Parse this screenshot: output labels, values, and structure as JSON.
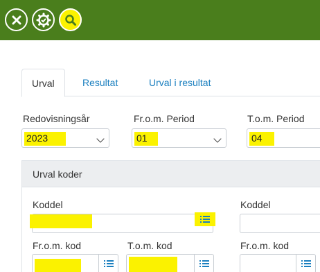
{
  "toolbar": {
    "buttons": [
      {
        "name": "close",
        "icon": "close-icon"
      },
      {
        "name": "settings",
        "icon": "gear-check-icon"
      },
      {
        "name": "search",
        "icon": "search-icon"
      }
    ],
    "colors": {
      "bar": "#4a7e1c",
      "highlight": "#fbf200",
      "link": "#1a7fbf"
    }
  },
  "tabs": [
    {
      "label": "Urval",
      "active": true
    },
    {
      "label": "Resultat",
      "active": false
    },
    {
      "label": "Urval i resultat",
      "active": false
    }
  ],
  "filters": {
    "year": {
      "label": "Redovisningsår",
      "value": "2023"
    },
    "from_period": {
      "label": "Fr.o.m. Period",
      "value": "01"
    },
    "to_period": {
      "label": "T.o.m. Period",
      "value": "04"
    }
  },
  "panel": {
    "title": "Urval koder",
    "left": {
      "koddel_label": "Koddel",
      "koddel_value": "",
      "from_kod_label": "Fr.o.m. kod",
      "to_kod_label": "T.o.m. kod"
    },
    "right": {
      "koddel_label": "Koddel",
      "koddel_value": "",
      "from_kod_label": "Fr.o.m. kod"
    }
  }
}
